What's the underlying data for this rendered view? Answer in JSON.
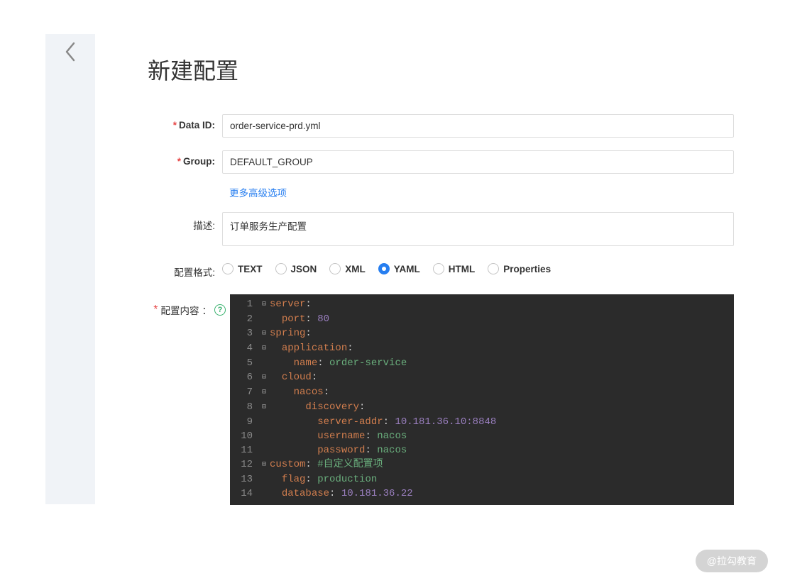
{
  "page_title": "新建配置",
  "labels": {
    "data_id": "Data ID:",
    "group": "Group:",
    "desc": "描述:",
    "format": "配置格式:",
    "content": "配置内容",
    "colon": "："
  },
  "fields": {
    "data_id": "order-service-prd.yml",
    "group": "DEFAULT_GROUP",
    "desc": "订单服务生产配置"
  },
  "adv_link": "更多高级选项",
  "formats": [
    {
      "label": "TEXT",
      "checked": false
    },
    {
      "label": "JSON",
      "checked": false
    },
    {
      "label": "XML",
      "checked": false
    },
    {
      "label": "YAML",
      "checked": true
    },
    {
      "label": "HTML",
      "checked": false
    },
    {
      "label": "Properties",
      "checked": false
    }
  ],
  "code": [
    {
      "n": 1,
      "fold": "⊟",
      "tokens": [
        {
          "t": "k",
          "x": "server"
        },
        {
          "t": "colon",
          "x": ":"
        }
      ]
    },
    {
      "n": 2,
      "fold": "",
      "tokens": [
        {
          "t": "p",
          "x": "  "
        },
        {
          "t": "k",
          "x": "port"
        },
        {
          "t": "colon",
          "x": ": "
        },
        {
          "t": "v",
          "x": "80"
        }
      ]
    },
    {
      "n": 3,
      "fold": "⊟",
      "tokens": [
        {
          "t": "k",
          "x": "spring"
        },
        {
          "t": "colon",
          "x": ":"
        }
      ]
    },
    {
      "n": 4,
      "fold": "⊟",
      "tokens": [
        {
          "t": "p",
          "x": "  "
        },
        {
          "t": "k",
          "x": "application"
        },
        {
          "t": "colon",
          "x": ":"
        }
      ]
    },
    {
      "n": 5,
      "fold": "",
      "tokens": [
        {
          "t": "p",
          "x": "    "
        },
        {
          "t": "k",
          "x": "name"
        },
        {
          "t": "colon",
          "x": ": "
        },
        {
          "t": "s",
          "x": "order-service"
        }
      ]
    },
    {
      "n": 6,
      "fold": "⊟",
      "tokens": [
        {
          "t": "p",
          "x": "  "
        },
        {
          "t": "k",
          "x": "cloud"
        },
        {
          "t": "colon",
          "x": ":"
        }
      ]
    },
    {
      "n": 7,
      "fold": "⊟",
      "tokens": [
        {
          "t": "p",
          "x": "    "
        },
        {
          "t": "k",
          "x": "nacos"
        },
        {
          "t": "colon",
          "x": ":"
        }
      ]
    },
    {
      "n": 8,
      "fold": "⊟",
      "tokens": [
        {
          "t": "p",
          "x": "      "
        },
        {
          "t": "k",
          "x": "discovery"
        },
        {
          "t": "colon",
          "x": ":"
        }
      ]
    },
    {
      "n": 9,
      "fold": "",
      "tokens": [
        {
          "t": "p",
          "x": "        "
        },
        {
          "t": "k",
          "x": "server-addr"
        },
        {
          "t": "colon",
          "x": ": "
        },
        {
          "t": "v",
          "x": "10.181.36.10:8848"
        }
      ]
    },
    {
      "n": 10,
      "fold": "",
      "tokens": [
        {
          "t": "p",
          "x": "        "
        },
        {
          "t": "k",
          "x": "username"
        },
        {
          "t": "colon",
          "x": ": "
        },
        {
          "t": "s",
          "x": "nacos"
        }
      ]
    },
    {
      "n": 11,
      "fold": "",
      "tokens": [
        {
          "t": "p",
          "x": "        "
        },
        {
          "t": "k",
          "x": "password"
        },
        {
          "t": "colon",
          "x": ": "
        },
        {
          "t": "s",
          "x": "nacos"
        }
      ]
    },
    {
      "n": 12,
      "fold": "⊟",
      "tokens": [
        {
          "t": "k",
          "x": "custom"
        },
        {
          "t": "colon",
          "x": ": "
        },
        {
          "t": "c",
          "x": "#自定义配置项"
        }
      ]
    },
    {
      "n": 13,
      "fold": "",
      "tokens": [
        {
          "t": "p",
          "x": "  "
        },
        {
          "t": "k",
          "x": "flag"
        },
        {
          "t": "colon",
          "x": ": "
        },
        {
          "t": "s",
          "x": "production"
        }
      ]
    },
    {
      "n": 14,
      "fold": "",
      "tokens": [
        {
          "t": "p",
          "x": "  "
        },
        {
          "t": "k",
          "x": "database"
        },
        {
          "t": "colon",
          "x": ": "
        },
        {
          "t": "v",
          "x": "10.181.36.22"
        }
      ]
    }
  ],
  "watermark": "@拉勾教育"
}
